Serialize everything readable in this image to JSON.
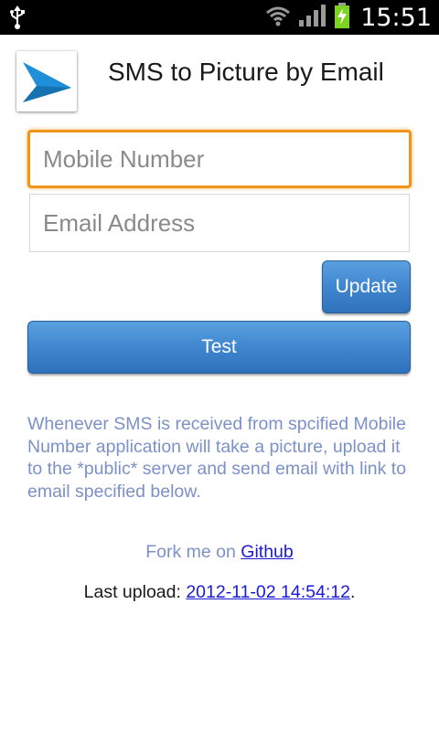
{
  "status_bar": {
    "time": "15:51",
    "icons": [
      "usb-icon",
      "wifi-icon",
      "signal-icon",
      "battery-charging-icon"
    ],
    "battery_color": "#7ed321"
  },
  "header": {
    "title": "SMS to Picture by Email",
    "icon": "send-arrow-icon",
    "icon_color": "#1e8fd8"
  },
  "form": {
    "mobile_placeholder": "Mobile Number",
    "mobile_value": "",
    "email_placeholder": "Email Address",
    "email_value": "",
    "update_label": "Update",
    "test_label": "Test"
  },
  "info": {
    "description": "Whenever SMS is received from spcified Mobile Number application will take a picture, upload it to the *public* server and send email with link to email specified below.",
    "fork_prefix": "Fork me on ",
    "fork_link": "Github",
    "upload_prefix": "Last upload: ",
    "upload_link": "2012-11-02 14:54:12",
    "upload_suffix": "."
  },
  "colors": {
    "focus_border": "#f0951a",
    "button": "#3f86cf",
    "info_text": "#7c91c9",
    "link": "#1a1ad6"
  }
}
